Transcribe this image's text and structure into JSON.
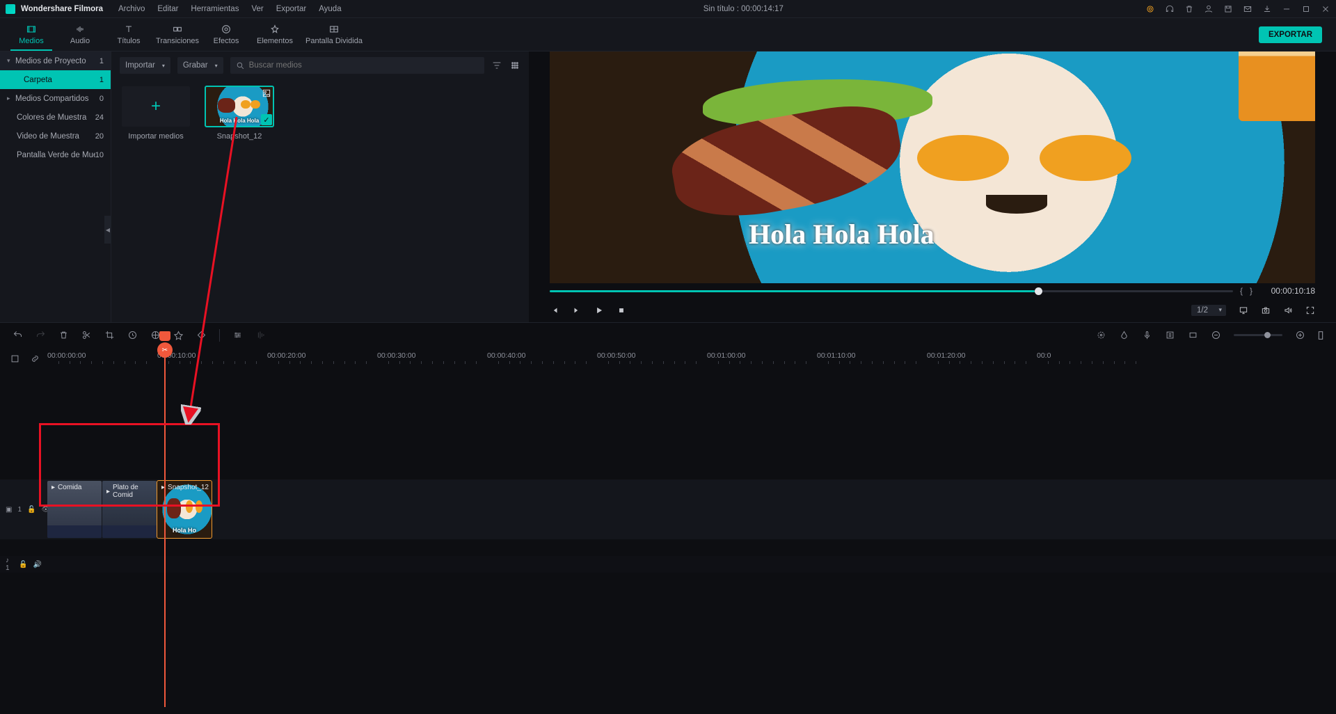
{
  "titlebar": {
    "app": "Wondershare Filmora",
    "menu": [
      "Archivo",
      "Editar",
      "Herramientas",
      "Ver",
      "Exportar",
      "Ayuda"
    ],
    "project": "Sin título : 00:00:14:17"
  },
  "tabs": [
    {
      "label": "Medios"
    },
    {
      "label": "Audio"
    },
    {
      "label": "Títulos"
    },
    {
      "label": "Transiciones"
    },
    {
      "label": "Efectos"
    },
    {
      "label": "Elementos"
    },
    {
      "label": "Pantalla Dividida"
    }
  ],
  "export_label": "EXPORTAR",
  "sidebar": {
    "items": [
      {
        "label": "Medios de Proyecto",
        "count": "1",
        "arrow": "▾"
      },
      {
        "label": "Carpeta",
        "count": "1"
      },
      {
        "label": "Medios Compartidos",
        "count": "0",
        "arrow": "▸"
      },
      {
        "label": "Colores de Muestra",
        "count": "24"
      },
      {
        "label": "Video de Muestra",
        "count": "20"
      },
      {
        "label": "Pantalla Verde de Mue",
        "count": "10"
      }
    ]
  },
  "media_panel": {
    "dd_import": "Importar",
    "dd_record": "Grabar",
    "search_placeholder": "Buscar medios",
    "import_label": "Importar medios",
    "clip_name": "Snapshot_12",
    "thumb_overlay": "Hola Hola Hola"
  },
  "preview": {
    "overlay_text": "Hola Hola Hola",
    "time": "00:00:10:18",
    "zoom": "1/2"
  },
  "ruler": {
    "marks": [
      "00:00:00:00",
      "00:00:10:00",
      "00:00:20:00",
      "00:00:30:00",
      "00:00:40:00",
      "00:00:50:00",
      "00:01:00:00",
      "00:01:10:00",
      "00:01:20:00",
      "00:0"
    ]
  },
  "timeline": {
    "video_track": "1",
    "audio_track": "♪ 1",
    "clip1": "Comida",
    "clip2": "Plato de Comid",
    "clip3": "Snapshot_12",
    "clip3_overlay": "Hola Ho"
  }
}
